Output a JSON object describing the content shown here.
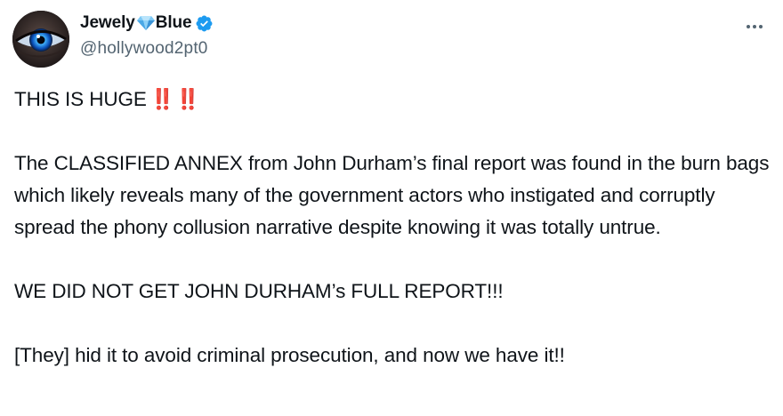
{
  "author": {
    "display_name_part1": "Jewely",
    "display_name_part2": "Blue",
    "handle": "@hollywood2pt0",
    "verified": true,
    "name_emoji": "gem-stone-icon",
    "verified_color": "#1d9bf0"
  },
  "more_menu_icon": "more-horizontal-icon",
  "tweet": {
    "headline": "THIS IS HUGE",
    "headline_emoji": "‼️ ‼️",
    "paragraph_2": "The CLASSIFIED ANNEX from John Durham’s final report was found in the burn bags which likely reveals many of the government actors who instigated and corruptly spread the phony collusion narrative despite knowing it was totally untrue.",
    "paragraph_3": "WE DID NOT GET JOHN DURHAM’s FULL REPORT!!!",
    "paragraph_4": "[They] hid it to avoid criminal prosecution, and now we have it!!"
  },
  "colors": {
    "text": "#0f1419",
    "secondary_text": "#536471",
    "accent": "#1d9bf0",
    "emoji_red": "#d21f3c"
  }
}
